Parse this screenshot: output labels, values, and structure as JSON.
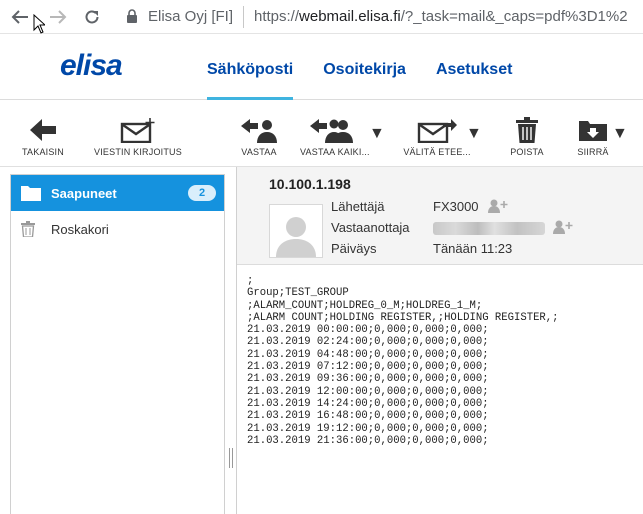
{
  "browser": {
    "site_identity": "Elisa Oyj [FI]",
    "url_scheme": "https://",
    "url_host": "webmail.elisa.fi",
    "url_rest": "/?_task=mail&_caps=pdf%3D1%2"
  },
  "app": {
    "logo_text": "elisa",
    "tabs": [
      "Sähköposti",
      "Osoitekirja",
      "Asetukset"
    ],
    "active_tab": 0,
    "accent_color": "#3fb4e0",
    "brand_color": "#0048a8"
  },
  "toolbar": {
    "back": "TAKAISIN",
    "compose": "VIESTIN KIRJOITUS",
    "reply": "VASTAA",
    "reply_all": "VASTAA KAIKI...",
    "forward": "VÄLITÄ ETEE...",
    "delete": "POISTA",
    "move": "SIIRRÄ"
  },
  "folders": [
    {
      "name": "Saapuneet",
      "icon": "folder-icon",
      "unread": "2",
      "active": true
    },
    {
      "name": "Roskakori",
      "icon": "trash-icon",
      "active": false
    }
  ],
  "message": {
    "subject": "10.100.1.198",
    "from_label": "Lähettäjä",
    "from_value": "FX3000",
    "to_label": "Vastaanottaja",
    "date_label": "Päiväys",
    "date_value": "Tänään 11:23",
    "body_lines": [
      ";",
      "Group;TEST_GROUP",
      ";ALARM_COUNT;HOLDREG_0_M;HOLDREG_1_M;",
      ";ALARM COUNT;HOLDING REGISTER,;HOLDING REGISTER,;",
      "21.03.2019 00:00:00;0,000;0,000;0,000;",
      "21.03.2019 02:24:00;0,000;0,000;0,000;",
      "21.03.2019 04:48:00;0,000;0,000;0,000;",
      "21.03.2019 07:12:00;0,000;0,000;0,000;",
      "21.03.2019 09:36:00;0,000;0,000;0,000;",
      "21.03.2019 12:00:00;0,000;0,000;0,000;",
      "21.03.2019 14:24:00;0,000;0,000;0,000;",
      "21.03.2019 16:48:00;0,000;0,000;0,000;",
      "21.03.2019 19:12:00;0,000;0,000;0,000;",
      "21.03.2019 21:36:00;0,000;0,000;0,000;"
    ]
  }
}
